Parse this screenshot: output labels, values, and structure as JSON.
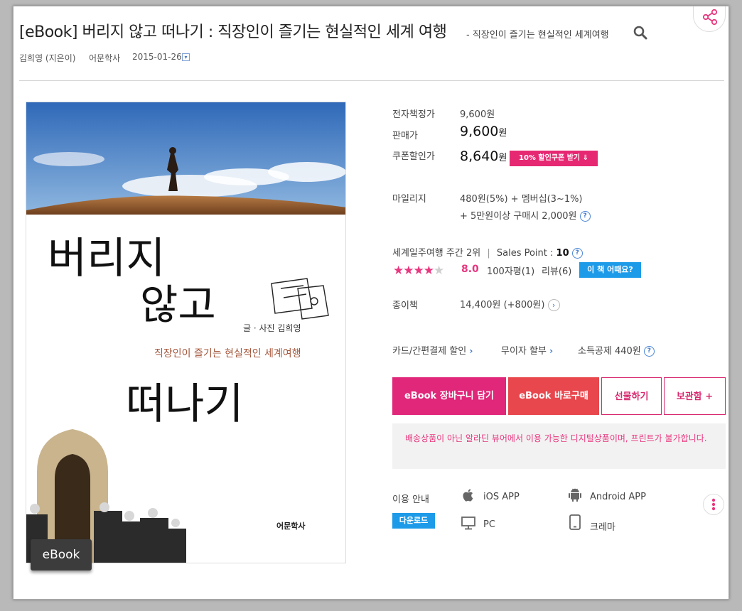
{
  "header": {
    "title": "[eBook] 버리지 않고 떠나기 : 직장인이 즐기는 현실적인 세계 여행",
    "subtitle": "- 직장인이 즐기는 현실적인 세계여행",
    "author": "김희영 (지은이)",
    "publisher": "어문학사",
    "date": "2015-01-26"
  },
  "cover": {
    "title_line1": "버리지",
    "title_line2": "않고",
    "title_line3": "떠나기",
    "byline": "글 · 사진 김희영",
    "tagline": "직장인이 즐기는 현실적인 세계여행",
    "publisher_mark": "어문학사",
    "badge": "eBook"
  },
  "price": {
    "list_label": "전자책정가",
    "list_value": "9,600원",
    "sale_label": "판매가",
    "sale_value": "9,600",
    "coupon_label": "쿠폰할인가",
    "coupon_value": "8,640",
    "won": "원",
    "coupon_button": "10% 할인쿠폰 받기 ⇓"
  },
  "mileage": {
    "label": "마일리지",
    "line1": "480원(5%) + 멤버십(3~1%)",
    "line2": "+ 5만원이상 구매시 2,000원"
  },
  "rank": {
    "text": "세계일주여행 주간 2위",
    "separator": "|",
    "sales_label": "Sales Point :",
    "sales_value": "10",
    "rating": 4,
    "score": "8.0",
    "review_count": "100자평(1)",
    "review": "리뷰(6)",
    "ask_button": "이 책 어때요?"
  },
  "paper": {
    "label": "종이책",
    "value": "14,400원 (+800원)"
  },
  "benefits": {
    "card": "카드/간편결제 할인",
    "installment": "무이자 할부",
    "deduction": "소득공제 440원"
  },
  "buttons": {
    "cart": "eBook 장바구니 담기",
    "buy": "eBook 바로구매",
    "gift": "선물하기",
    "wishlist": "보관함 +"
  },
  "notice": "배송상품이 아닌 알라딘 뷰어에서 이용 가능한 디지털상품이며, 프린트가 불가합니다.",
  "usage": {
    "label": "이용 안내",
    "download": "다운로드",
    "ios": "iOS APP",
    "android": "Android APP",
    "pc": "PC",
    "crema": "크레마"
  },
  "colors": {
    "accent_pink": "#e0277a",
    "accent_red": "#e8474d",
    "accent_blue": "#1d9be9"
  }
}
